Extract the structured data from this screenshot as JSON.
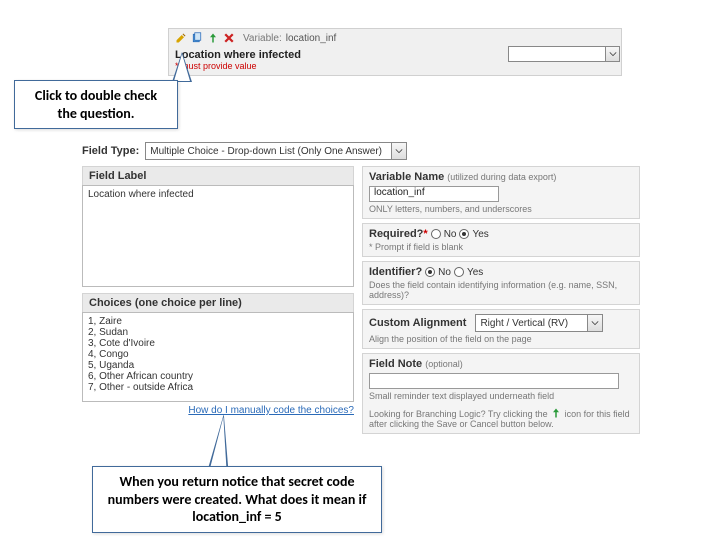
{
  "topbar": {
    "variable_label": "Variable:",
    "variable_name": "location_inf",
    "question": "Location where infected",
    "required_note": "* must provide value"
  },
  "editor": {
    "field_type_label": "Field Type:",
    "field_type_value": "Multiple Choice - Drop-down List (Only One Answer)",
    "field_label_head": "Field Label",
    "field_label_value": "Location where infected",
    "choices_head": "Choices (one choice per line)",
    "choices_text": "1, Zaire\n2, Sudan\n3, Cote d'Ivoire\n4, Congo\n5, Uganda\n6, Other African country\n7, Other - outside Africa",
    "choices_link": "How do I manually code the choices?",
    "var_name_head": "Variable Name",
    "var_name_hint": "(utilized during data export)",
    "var_name_value": "location_inf",
    "var_name_rule": "ONLY letters, numbers, and underscores",
    "required_head": "Required?",
    "no": "No",
    "yes": "Yes",
    "required_hint": "* Prompt if field is blank",
    "identifier_head": "Identifier?",
    "identifier_hint": "Does the field contain identifying information (e.g. name, SSN, address)?",
    "align_head": "Custom Alignment",
    "align_value": "Right / Vertical (RV)",
    "align_hint": "Align the position of the field on the page",
    "note_head": "Field Note",
    "optional": "(optional)",
    "note_hint": "Small reminder text displayed underneath field",
    "branch_hint1": "Looking for Branching Logic? Try clicking the ",
    "branch_hint2": " icon for this field after clicking the Save or Cancel button below."
  },
  "callouts": {
    "c1": "Click to double check the question.",
    "c2": "When you return notice that secret code numbers were created.  What does it mean if  location_inf = 5"
  }
}
